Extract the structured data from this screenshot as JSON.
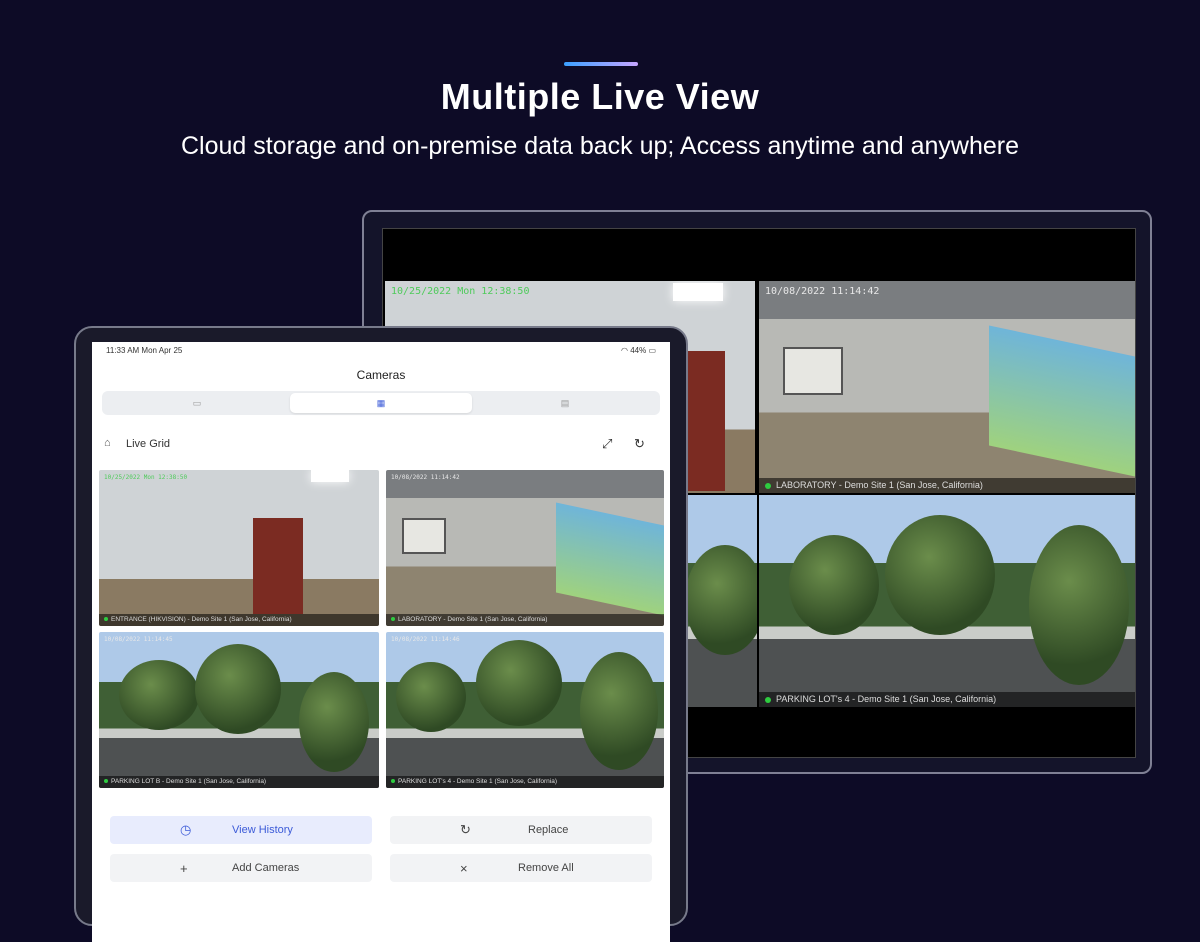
{
  "hero": {
    "title": "Multiple Live View",
    "subtitle": "Cloud storage and on-premise data back up; Access anytime and anywhere"
  },
  "monitor": {
    "feeds": [
      {
        "timestamp": "10/25/2022 Mon 12:38:50",
        "caption": ""
      },
      {
        "timestamp": "10/08/2022 11:14:42",
        "caption": "LABORATORY - Demo Site 1 (San Jose, California)"
      },
      {
        "timestamp": "",
        "caption": ""
      },
      {
        "timestamp": "",
        "caption": "PARKING LOT's 4 - Demo Site 1 (San Jose, California)"
      }
    ]
  },
  "tablet": {
    "status": {
      "time": "11:33 AM   Mon Apr 25",
      "battery": "44%"
    },
    "title": "Cameras",
    "segments": [
      "single-view-icon",
      "grid-view-icon",
      "list-view-icon"
    ],
    "grid_label": "Live Grid",
    "feeds": [
      {
        "timestamp": "10/25/2022 Mon 12:38:50",
        "caption": "ENTRANCE (HIKVISION) - Demo Site 1 (San Jose, California)"
      },
      {
        "timestamp": "10/08/2022 11:14:42",
        "caption": "LABORATORY - Demo Site 1 (San Jose, California)"
      },
      {
        "timestamp": "10/08/2022 11:14:45",
        "caption": "PARKING LOT B - Demo Site 1 (San Jose, California)"
      },
      {
        "timestamp": "10/08/2022 11:14:46",
        "caption": "PARKING LOT's 4 - Demo Site 1 (San Jose, California)"
      }
    ],
    "actions": {
      "view_history": "View History",
      "replace": "Replace",
      "add_cameras": "Add Cameras",
      "remove_all": "Remove All"
    }
  }
}
